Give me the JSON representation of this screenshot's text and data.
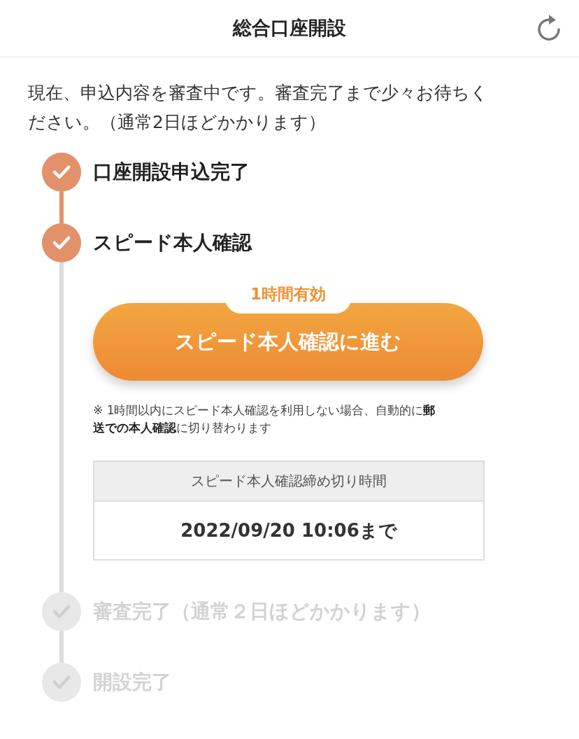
{
  "header": {
    "title": "総合口座開設"
  },
  "message": "現在、申込内容を審査中です。審査完了まで少々お待ちください。（通常2日ほどかかります）",
  "steps": [
    {
      "label": "口座開設申込完了",
      "done": true
    },
    {
      "label": "スピード本人確認",
      "done": true,
      "action": {
        "badge": "1時間有効",
        "button": "スピード本人確認に進む",
        "note": "※ 1時間以内にスピード本人確認を利用しない場合、自動的に**郵送での本人確認**に切り替わります",
        "deadline": {
          "heading": "スピード本人確認締め切り時間",
          "value": "2022/09/20 10:06まで"
        }
      }
    },
    {
      "label": "審査完了（通常２日ほどかかります）",
      "done": false
    },
    {
      "label": "開設完了",
      "done": false
    }
  ]
}
